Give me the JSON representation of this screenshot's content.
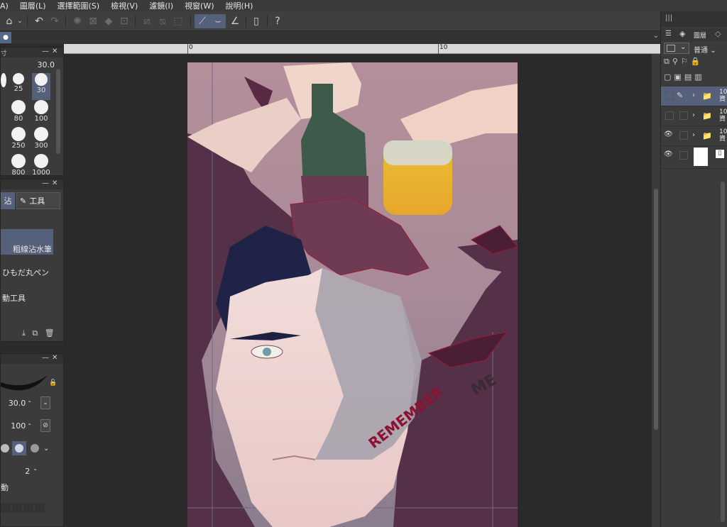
{
  "menu": [
    "A)",
    "圖層(L)",
    "選擇範圍(S)",
    "檢視(V)",
    "濾鏡(I)",
    "視窗(W)",
    "說明(H)"
  ],
  "brush_size_panel": {
    "size_value": "30.0",
    "sizes": [
      "25",
      "30",
      "80",
      "100",
      "250",
      "300",
      "800",
      "1000"
    ]
  },
  "tool_panel": {
    "tab_left": "沾",
    "tab_right": "工具",
    "items": [
      "粗線沾水筆",
      "ひもだ丸ペン",
      "動工具"
    ]
  },
  "tool_property": {
    "brush_size": "30.0",
    "opacity": "100",
    "stabilization": "2",
    "label": "動"
  },
  "ruler": {
    "label0": "0",
    "label10": "10"
  },
  "right_panel": {
    "tab_label": "圖層",
    "blend_mode": "普通",
    "layers": [
      {
        "name": "10",
        "name2": "資",
        "selected": true
      },
      {
        "name": "10",
        "name2": "資",
        "selected": false
      },
      {
        "name": "10",
        "name2": "資",
        "selected": false
      },
      {
        "name": "",
        "name2": "",
        "selected": false
      }
    ]
  },
  "artwork": {
    "text": "REMEMBER",
    "text2": "ME"
  },
  "colors": {
    "accent": "#55617a",
    "bg_purple": "#553049",
    "sky": "#b0909b"
  }
}
